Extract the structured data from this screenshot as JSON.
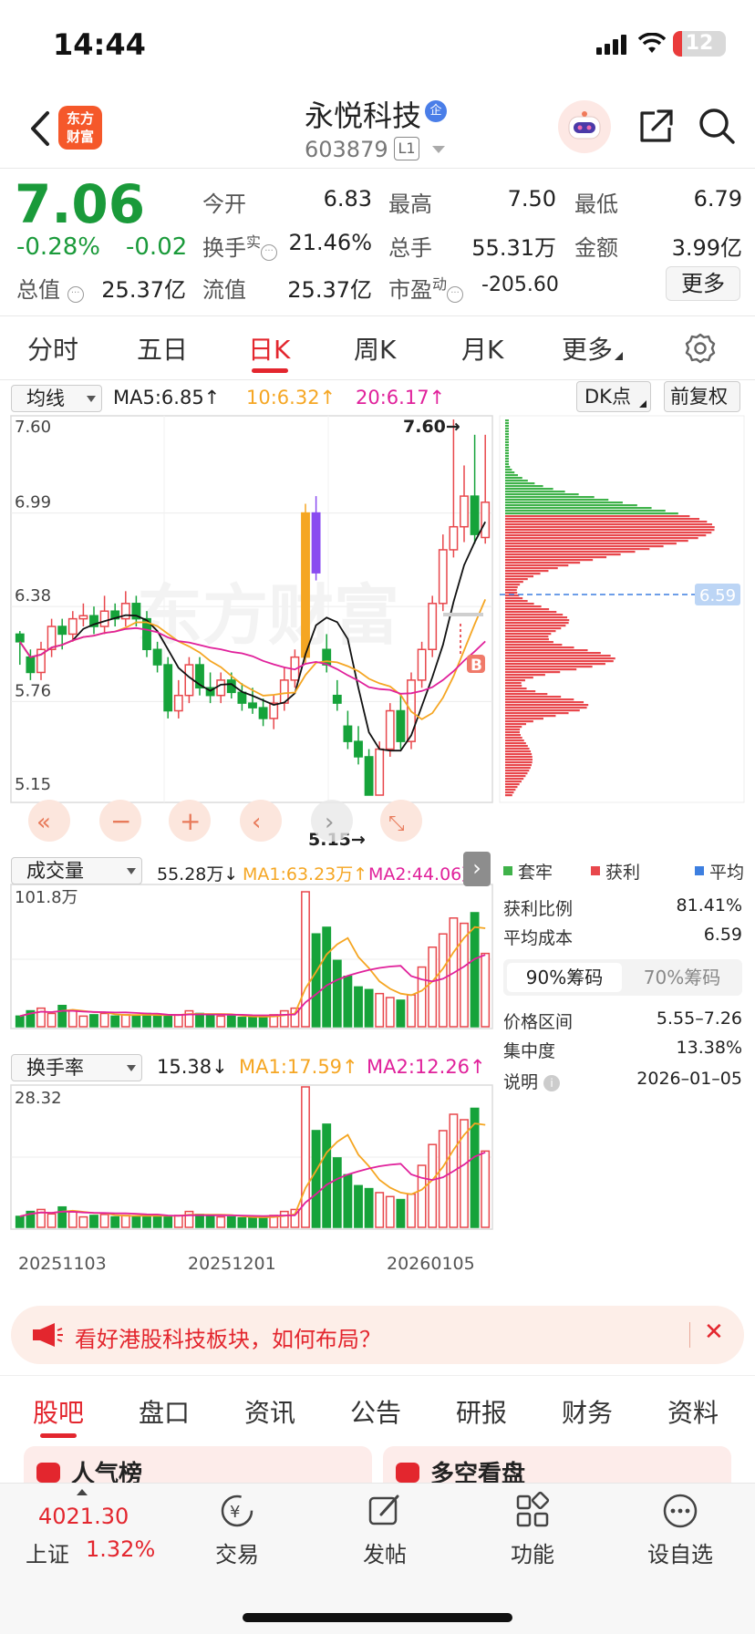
{
  "status_bar": {
    "time": "14:44",
    "battery": "12"
  },
  "header": {
    "logo_line1": "东方",
    "logo_line2": "财富",
    "stock_name": "永悦科技",
    "enterprise_badge": "企",
    "stock_code": "603879",
    "level": "L1"
  },
  "quote": {
    "price": "7.06",
    "change_pct": "-0.28%",
    "change": "-0.02",
    "fields": {
      "open_label": "今开",
      "open": "6.83",
      "high_label": "最高",
      "high": "7.50",
      "low_label": "最低",
      "low": "6.79",
      "turnover_label": "换手",
      "turnover_sup": "实",
      "turnover": "21.46%",
      "volume_label": "总手",
      "volume": "55.31万",
      "amount_label": "金额",
      "amount": "3.99亿",
      "mktcap_label": "总值",
      "mktcap": "25.37亿",
      "float_label": "流值",
      "float": "25.37亿",
      "pe_label": "市盈",
      "pe_sup": "动",
      "pe": "-205.60"
    },
    "more_button": "更多"
  },
  "period_tabs": [
    "分时",
    "五日",
    "日K",
    "周K",
    "月K",
    "更多"
  ],
  "ma_row": {
    "selector": "均线",
    "ma5": "MA5:6.85↑",
    "ma10": "10:6.32↑",
    "ma20": "20:6.17↑",
    "dk_button": "DK点",
    "adjust_button": "前复权"
  },
  "kline": {
    "y_labels": [
      "7.60",
      "6.99",
      "6.38",
      "5.76",
      "5.15"
    ],
    "high_marker": "7.60→",
    "low_marker": "5.15→",
    "watermark": "东方财富",
    "b_marker": "B",
    "cost_line_value": "6.59"
  },
  "volume": {
    "selector": "成交量",
    "value": "55.28万↓",
    "ma1": "MA1:63.23万↑",
    "ma2": "MA2:44.06万",
    "max_label": "101.8万"
  },
  "turnover": {
    "selector": "换手率",
    "value": "15.38↓",
    "ma1": "MA1:17.59↑",
    "ma2": "MA2:12.26↑",
    "max_label": "28.32"
  },
  "x_labels": [
    "20251103",
    "20251201",
    "20260105"
  ],
  "chips": {
    "legend": [
      {
        "label": "套牢",
        "color": "#3fb24a"
      },
      {
        "label": "获利",
        "color": "#e8474c"
      },
      {
        "label": "平均",
        "color": "#3d7fe0"
      }
    ],
    "profit_ratio_label": "获利比例",
    "profit_ratio": "81.41%",
    "avg_cost_label": "平均成本",
    "avg_cost": "6.59",
    "tab_90": "90%筹码",
    "tab_70": "70%筹码",
    "range_label": "价格区间",
    "range": "5.55–7.26",
    "concentration_label": "集中度",
    "concentration": "13.38%",
    "note_label": "说明",
    "date": "2026–01–05"
  },
  "banner": {
    "text": "看好港股科技板块，如何布局？"
  },
  "section_tabs": [
    "股吧",
    "盘口",
    "资讯",
    "公告",
    "研报",
    "财务",
    "资料"
  ],
  "peek": {
    "left": "人气榜",
    "right": "多空看盘"
  },
  "bottom_nav": {
    "index_value": "4021.30",
    "index_name": "上证",
    "index_change": "1.32%",
    "items": [
      "交易",
      "发帖",
      "功能",
      "设自选"
    ]
  },
  "chart_data": [
    {
      "type": "candlestick",
      "title": "",
      "ylim": [
        5.15,
        7.6
      ],
      "x_labels": [
        "20251103",
        "20251201",
        "20260105"
      ],
      "series": [
        {
          "name": "MA5",
          "last": 6.85
        },
        {
          "name": "MA10",
          "last": 6.32
        },
        {
          "name": "MA20",
          "last": 6.17
        }
      ],
      "ohlc": [
        [
          6.2,
          6.15,
          6.22,
          6.0
        ],
        [
          6.05,
          5.95,
          6.1,
          5.9
        ],
        [
          5.95,
          6.1,
          6.15,
          5.9
        ],
        [
          6.1,
          6.25,
          6.3,
          6.05
        ],
        [
          6.25,
          6.2,
          6.3,
          6.1
        ],
        [
          6.2,
          6.3,
          6.35,
          6.15
        ],
        [
          6.3,
          6.32,
          6.4,
          6.25
        ],
        [
          6.32,
          6.25,
          6.38,
          6.2
        ],
        [
          6.25,
          6.35,
          6.45,
          6.2
        ],
        [
          6.35,
          6.3,
          6.4,
          6.25
        ],
        [
          6.3,
          6.4,
          6.48,
          6.25
        ],
        [
          6.4,
          6.3,
          6.45,
          6.25
        ],
        [
          6.3,
          6.1,
          6.35,
          6.05
        ],
        [
          6.1,
          6.0,
          6.15,
          5.95
        ],
        [
          6.0,
          5.7,
          6.05,
          5.65
        ],
        [
          5.7,
          5.8,
          5.9,
          5.65
        ],
        [
          5.8,
          6.0,
          6.05,
          5.75
        ],
        [
          6.0,
          5.85,
          6.05,
          5.8
        ],
        [
          5.85,
          5.8,
          5.95,
          5.75
        ],
        [
          5.8,
          5.9,
          5.95,
          5.75
        ],
        [
          5.9,
          5.82,
          5.95,
          5.78
        ],
        [
          5.82,
          5.75,
          5.88,
          5.7
        ],
        [
          5.75,
          5.72,
          5.85,
          5.68
        ],
        [
          5.72,
          5.65,
          5.78,
          5.6
        ],
        [
          5.65,
          5.75,
          5.8,
          5.58
        ],
        [
          5.75,
          5.9,
          5.98,
          5.7
        ],
        [
          5.9,
          6.05,
          6.1,
          5.85
        ],
        [
          6.05,
          6.99,
          7.05,
          6.0
        ],
        [
          6.99,
          6.6,
          7.1,
          6.55
        ],
        [
          6.1,
          6.0,
          6.2,
          5.95
        ],
        [
          5.8,
          5.75,
          5.9,
          5.7
        ],
        [
          5.6,
          5.5,
          5.7,
          5.45
        ],
        [
          5.5,
          5.4,
          5.6,
          5.35
        ],
        [
          5.4,
          5.15,
          5.45,
          5.15
        ],
        [
          5.15,
          5.45,
          5.5,
          5.15
        ],
        [
          5.45,
          5.7,
          5.75,
          5.4
        ],
        [
          5.7,
          5.5,
          5.8,
          5.45
        ],
        [
          5.5,
          5.9,
          5.95,
          5.45
        ],
        [
          5.9,
          6.1,
          6.15,
          5.85
        ],
        [
          6.1,
          6.4,
          6.45,
          6.05
        ],
        [
          6.4,
          6.75,
          6.85,
          6.35
        ],
        [
          6.75,
          6.9,
          7.6,
          6.7
        ],
        [
          6.9,
          7.1,
          7.3,
          6.8
        ],
        [
          7.1,
          6.85,
          7.5,
          6.79
        ],
        [
          6.83,
          7.06,
          7.5,
          6.79
        ]
      ]
    },
    {
      "type": "bar",
      "title": "成交量",
      "ylim": [
        0,
        101.8
      ],
      "series": [
        {
          "name": "MA1",
          "last": 63.23
        },
        {
          "name": "MA2",
          "last": 44.06
        }
      ],
      "values": [
        8,
        12,
        14,
        10,
        16,
        12,
        8,
        9,
        10,
        8,
        9,
        8,
        10,
        9,
        8,
        9,
        12,
        10,
        9,
        8,
        8,
        7,
        7,
        8,
        9,
        12,
        14,
        101.8,
        70,
        75,
        50,
        38,
        30,
        28,
        25,
        22,
        20,
        24,
        45,
        60,
        70,
        82,
        78,
        86,
        55.28
      ]
    },
    {
      "type": "bar",
      "title": "换手率",
      "ylim": [
        0,
        28.32
      ],
      "series": [
        {
          "name": "MA1",
          "last": 17.59
        },
        {
          "name": "MA2",
          "last": 12.26
        }
      ],
      "values": [
        2.2,
        3.2,
        3.6,
        2.7,
        4.1,
        3.1,
        2.1,
        2.4,
        2.6,
        2.1,
        2.4,
        2.1,
        2.6,
        2.4,
        2.1,
        2.4,
        3.2,
        2.6,
        2.4,
        2.1,
        2.1,
        1.9,
        1.9,
        2.1,
        2.4,
        3.2,
        3.6,
        28.32,
        19.5,
        20.8,
        14,
        10.6,
        8.4,
        7.8,
        7,
        6.2,
        5.6,
        6.7,
        12.5,
        16.7,
        19.5,
        22.8,
        21.7,
        24,
        15.38
      ]
    }
  ]
}
